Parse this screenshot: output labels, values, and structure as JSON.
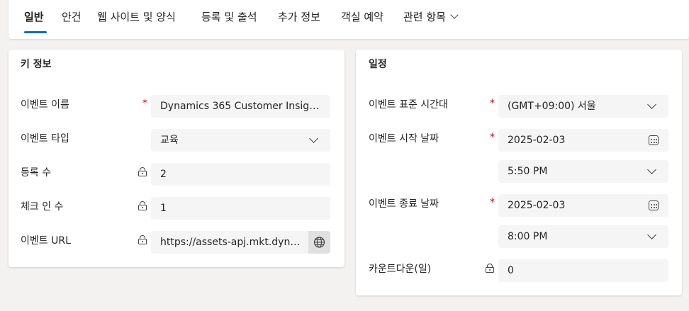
{
  "tabs": [
    {
      "label": "일반",
      "active": true
    },
    {
      "label": "안건"
    },
    {
      "label": "웹 사이트 및 양식"
    },
    {
      "label": "등록 및 출석"
    },
    {
      "label": "추가 정보"
    },
    {
      "label": "객실 예약"
    },
    {
      "label": "관련 항목"
    }
  ],
  "key_info": {
    "title": "키 정보",
    "event_name": {
      "label": "이벤트 이름",
      "value": "Dynamics 365 Customer Insights ..."
    },
    "event_type": {
      "label": "이벤트 타입",
      "value": "교육"
    },
    "registrations": {
      "label": "등록 수",
      "value": "2"
    },
    "checkins": {
      "label": "체크 인 수",
      "value": "1"
    },
    "event_url": {
      "label": "이벤트 URL",
      "value": "https://assets-apj.mkt.dynami..."
    }
  },
  "schedule": {
    "title": "일정",
    "timezone": {
      "label": "이벤트 표준 시간대",
      "value": "(GMT+09:00) 서울"
    },
    "start": {
      "label": "이벤트 시작 날짜",
      "date": "2025-02-03",
      "time": "5:50 PM"
    },
    "end": {
      "label": "이벤트 종료 날짜",
      "date": "2025-02-03",
      "time": "8:00 PM"
    },
    "countdown": {
      "label": "카운트다운(일)",
      "value": "0"
    }
  },
  "required_mark": "*",
  "icons": [
    "chevron-down-icon",
    "lock-icon",
    "calendar-icon",
    "globe-icon"
  ],
  "colors": {
    "accent": "#0f6cbd",
    "required": "#c50f1f",
    "field_bg": "#f5f5f5"
  }
}
